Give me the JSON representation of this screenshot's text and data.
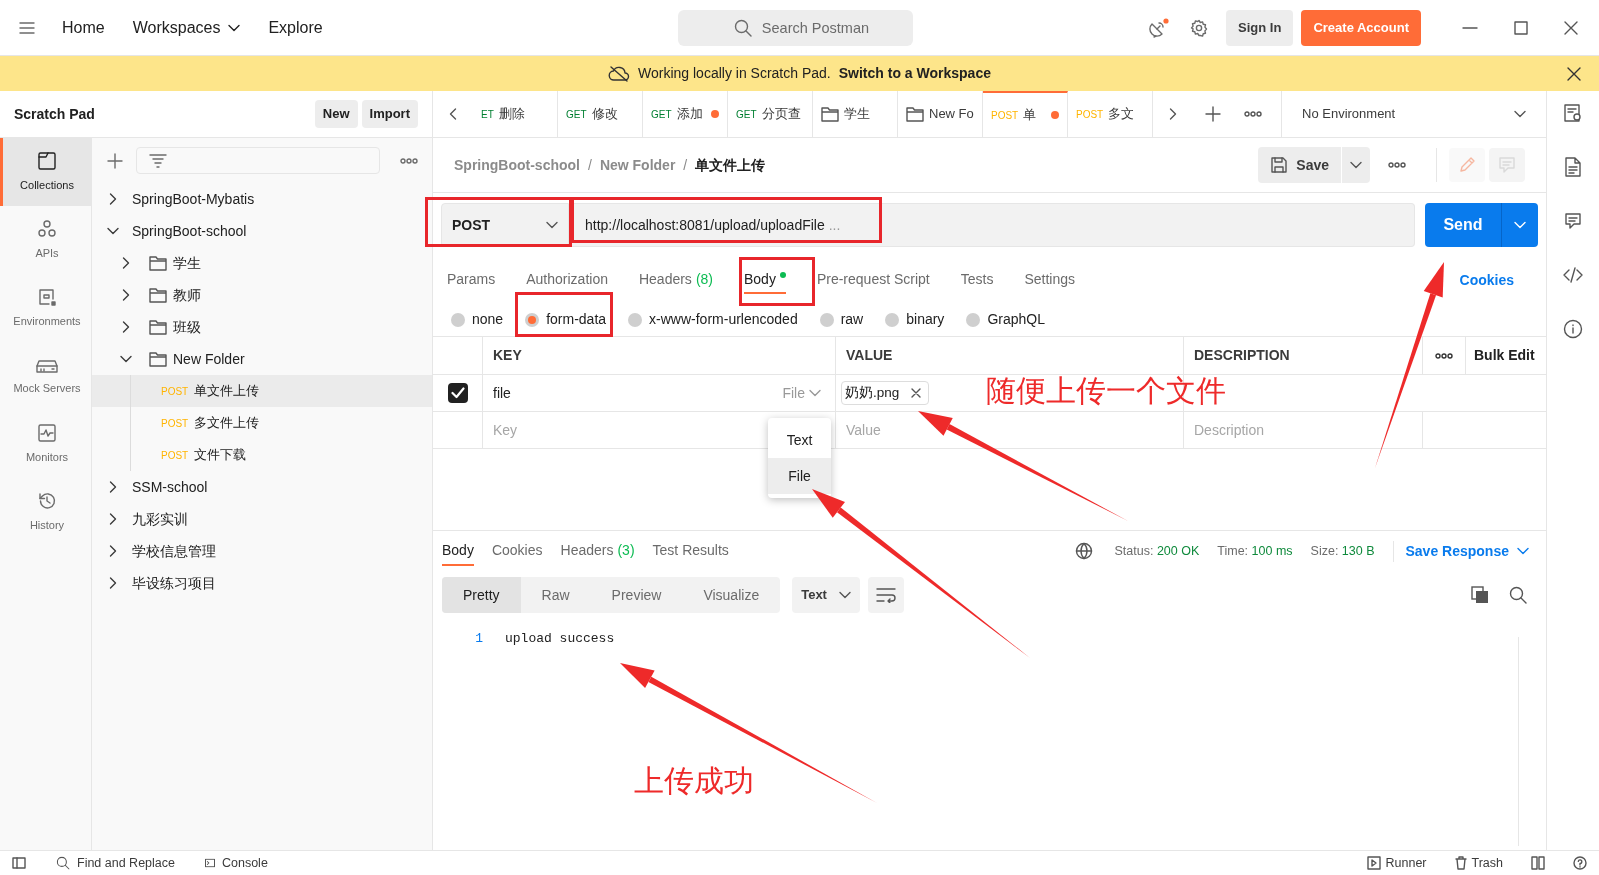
{
  "topbar": {
    "nav": [
      {
        "label": "Home",
        "has_menu": false
      },
      {
        "label": "Workspaces",
        "has_menu": true
      },
      {
        "label": "Explore",
        "has_menu": false
      }
    ],
    "search": {
      "placeholder": "Search Postman"
    },
    "sign_in": "Sign In",
    "create_account": "Create Account"
  },
  "banner": {
    "text": "Working locally in Scratch Pad.",
    "link": "Switch to a Workspace"
  },
  "scratch_pad": {
    "title": "Scratch Pad",
    "buttons": [
      "New",
      "Import"
    ]
  },
  "nav_rail": [
    {
      "label": "Collections",
      "selected": true
    },
    {
      "label": "APIs",
      "selected": false
    },
    {
      "label": "Environments",
      "selected": false
    },
    {
      "label": "Mock Servers",
      "selected": false
    },
    {
      "label": "Monitors",
      "selected": false
    },
    {
      "label": "History",
      "selected": false
    }
  ],
  "tree": [
    {
      "kind": "collection",
      "label": "SpringBoot-Mybatis",
      "expanded": false
    },
    {
      "kind": "collection",
      "label": "SpringBoot-school",
      "expanded": true,
      "children": [
        {
          "kind": "folder",
          "label": "学生",
          "expanded": false
        },
        {
          "kind": "folder",
          "label": "教师",
          "expanded": false
        },
        {
          "kind": "folder",
          "label": "班级",
          "expanded": false
        },
        {
          "kind": "folder",
          "label": "New Folder",
          "expanded": true,
          "children": [
            {
              "kind": "request",
              "method": "POST",
              "label": "单文件上传",
              "selected": true
            },
            {
              "kind": "request",
              "method": "POST",
              "label": "多文件上传",
              "selected": false
            },
            {
              "kind": "request",
              "method": "POST",
              "label": "文件下载",
              "selected": false
            }
          ]
        }
      ]
    },
    {
      "kind": "collection",
      "label": "SSM-school",
      "expanded": false
    },
    {
      "kind": "collection",
      "label": "九彩实训",
      "expanded": false
    },
    {
      "kind": "collection",
      "label": "学校信息管理",
      "expanded": false
    },
    {
      "kind": "collection",
      "label": "毕设练习项目",
      "expanded": false
    }
  ],
  "request_tabs": [
    {
      "kind": "request",
      "method": "ET",
      "label": "删除",
      "unsaved": false,
      "selected": false
    },
    {
      "kind": "request",
      "method": "GET",
      "label": "修改",
      "unsaved": false,
      "selected": false
    },
    {
      "kind": "request",
      "method": "GET",
      "label": "添加",
      "unsaved": true,
      "selected": false
    },
    {
      "kind": "request",
      "method": "GET",
      "label": "分页查",
      "unsaved": false,
      "selected": false
    },
    {
      "kind": "folder",
      "label": "学生",
      "unsaved": false,
      "selected": false
    },
    {
      "kind": "folder",
      "label": "New Fo",
      "unsaved": false,
      "selected": false
    },
    {
      "kind": "request",
      "method": "POST",
      "label": "单",
      "unsaved": true,
      "selected": true
    },
    {
      "kind": "request",
      "method": "POST",
      "label": "多文",
      "unsaved": false,
      "selected": false
    }
  ],
  "environment": "No Environment",
  "breadcrumb": [
    {
      "kind": "link",
      "text": "SpringBoot-school"
    },
    {
      "kind": "separator",
      "text": "/"
    },
    {
      "kind": "link",
      "text": "New Folder"
    },
    {
      "kind": "separator",
      "text": "/"
    },
    {
      "kind": "current",
      "text": "单文件上传"
    }
  ],
  "save": "Save",
  "request": {
    "method": "POST",
    "url": "http://localhost:8081/upload/uploadFile",
    "url_more": "...",
    "send": "Send"
  },
  "request_sections": [
    {
      "label": "Params",
      "selected": false
    },
    {
      "label": "Authorization",
      "selected": false
    },
    {
      "label": "Headers",
      "count": "(8)",
      "selected": false
    },
    {
      "label": "Body",
      "dot": true,
      "selected": true
    },
    {
      "label": "Pre-request Script",
      "selected": false
    },
    {
      "label": "Tests",
      "selected": false
    },
    {
      "label": "Settings",
      "selected": false
    }
  ],
  "cookies_link": "Cookies",
  "body_types": [
    {
      "label": "none",
      "selected": false
    },
    {
      "label": "form-data",
      "selected": true
    },
    {
      "label": "x-www-form-urlencoded",
      "selected": false
    },
    {
      "label": "raw",
      "selected": false
    },
    {
      "label": "binary",
      "selected": false
    },
    {
      "label": "GraphQL",
      "selected": false
    }
  ],
  "form_table": {
    "columns": [
      "KEY",
      "VALUE",
      "DESCRIPTION"
    ],
    "bulk_edit": "Bulk Edit",
    "rows": [
      {
        "checked": true,
        "key": "file",
        "type": "File",
        "file": "奶奶.png"
      }
    ],
    "empty_row": {
      "key": {
        "placeholder": "Key"
      },
      "value": {
        "placeholder": "Value"
      },
      "description": {
        "placeholder": "Description"
      }
    }
  },
  "type_menu": [
    {
      "label": "Text",
      "selected": false
    },
    {
      "label": "File",
      "selected": true
    }
  ],
  "response": {
    "tabs": [
      {
        "label": "Body",
        "selected": true
      },
      {
        "label": "Cookies",
        "selected": false
      },
      {
        "label": "Headers",
        "count": "(3)",
        "selected": false
      },
      {
        "label": "Test Results",
        "selected": false
      }
    ],
    "stats": [
      {
        "label": "Status:",
        "value": "200 OK"
      },
      {
        "label": "Time:",
        "value": "100 ms"
      },
      {
        "label": "Size:",
        "value": "130 B"
      }
    ],
    "save_response": "Save Response",
    "views": [
      {
        "label": "Pretty",
        "selected": true
      },
      {
        "label": "Raw",
        "selected": false
      },
      {
        "label": "Preview",
        "selected": false
      },
      {
        "label": "Visualize",
        "selected": false
      }
    ],
    "format": "Text",
    "lines": [
      {
        "number": "1",
        "text": "upload success"
      }
    ]
  },
  "status_bar": {
    "left": [
      "Find and Replace",
      "Console"
    ],
    "right": [
      "Runner",
      "Trash"
    ]
  },
  "annotations": [
    "随便上传一个文件",
    "上传成功"
  ]
}
